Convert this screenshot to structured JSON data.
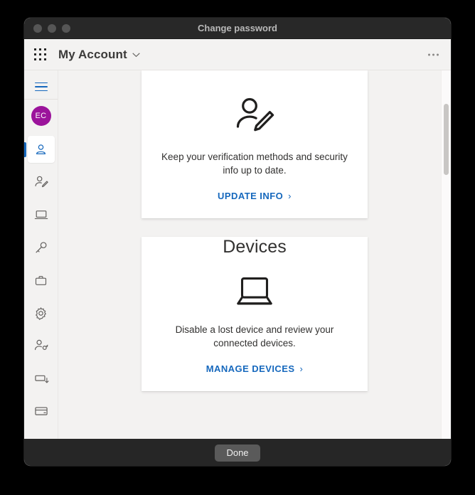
{
  "window": {
    "titlebar_title": "Change password",
    "traffic_lights": [
      "close",
      "minimize",
      "maximize"
    ]
  },
  "header": {
    "waffle_icon": "app-launcher-grid-icon",
    "app_title": "My Account",
    "chevron": "⌄",
    "more_icon": "ellipsis-icon"
  },
  "sidebar": {
    "hamburger_icon": "hamburger-menu-icon",
    "avatar_initials": "EC",
    "avatar_color": "#9b139b",
    "accent_color": "#1668bd",
    "items": [
      {
        "name": "overview",
        "icon": "person-icon",
        "selected": true
      },
      {
        "name": "security-info",
        "icon": "person-edit-icon",
        "selected": false
      },
      {
        "name": "devices",
        "icon": "laptop-icon",
        "selected": false
      },
      {
        "name": "password",
        "icon": "key-icon",
        "selected": false
      },
      {
        "name": "organizations",
        "icon": "briefcase-icon",
        "selected": false
      },
      {
        "name": "settings-privacy",
        "icon": "gear-icon",
        "selected": false
      },
      {
        "name": "my-sign-ins",
        "icon": "person-key-icon",
        "selected": false
      },
      {
        "name": "office-apps",
        "icon": "box-download-icon",
        "selected": false
      },
      {
        "name": "subscriptions",
        "icon": "credit-card-icon",
        "selected": false
      }
    ]
  },
  "cards": [
    {
      "title": "",
      "icon": "person-edit-icon",
      "description": "Keep your verification methods and security info up to date.",
      "link_label": "UPDATE INFO",
      "link_chevron": "›"
    },
    {
      "title": "Devices",
      "icon": "laptop-icon",
      "description": "Disable a lost device and review your connected devices.",
      "link_label": "MANAGE DEVICES",
      "link_chevron": "›"
    }
  ],
  "scrollbar": {
    "name": "vertical-scrollbar"
  },
  "footer": {
    "done_label": "Done"
  }
}
